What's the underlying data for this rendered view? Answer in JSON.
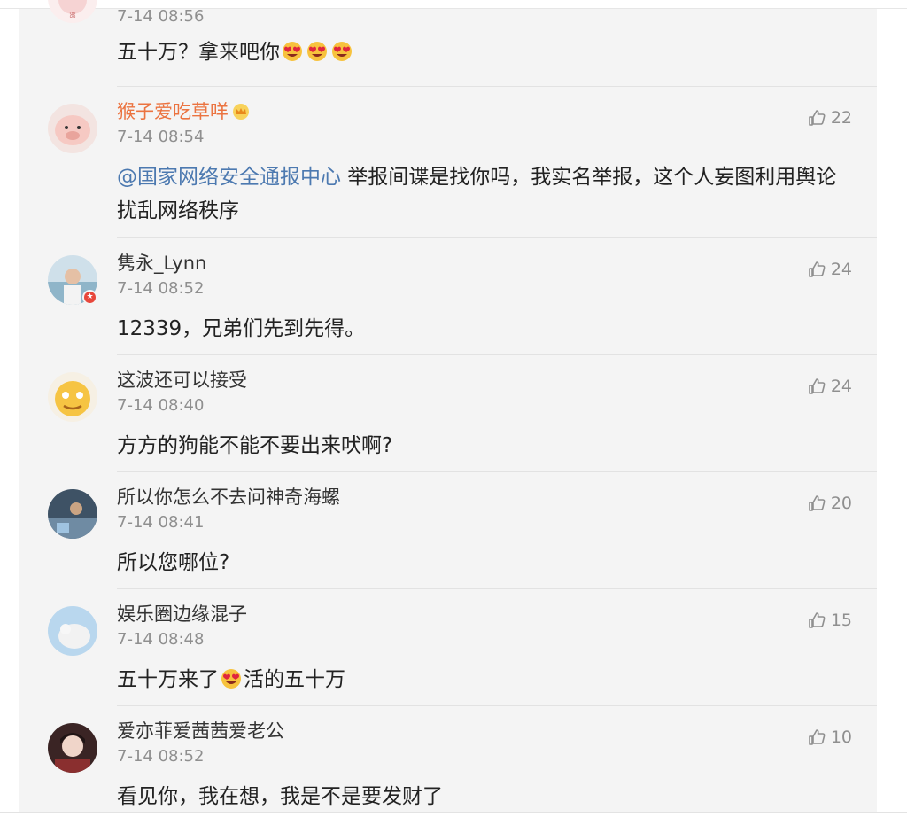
{
  "comments": [
    {
      "name": "",
      "time": "7-14 08:56",
      "text": "五十万？拿来吧你",
      "likes": ""
    },
    {
      "name": "猴子爱吃草咩",
      "time": "7-14 08:54",
      "mention": "@国家网络安全通报中心",
      "text": " 举报间谍是找你吗，我实名举报，这个人妄图利用舆论扰乱网络秩序",
      "likes": "22"
    },
    {
      "name": "隽永_Lynn",
      "time": "7-14 08:52",
      "text": "12339，兄弟们先到先得。",
      "likes": "24"
    },
    {
      "name": "这波还可以接受",
      "time": "7-14 08:40",
      "text": "方方的狗能不能不要出来吠啊?",
      "likes": "24"
    },
    {
      "name": "所以你怎么不去问神奇海螺",
      "time": "7-14 08:41",
      "text": "所以您哪位?",
      "likes": "20"
    },
    {
      "name": "娱乐圈边缘混子",
      "time": "7-14 08:48",
      "text_before": "五十万来了",
      "text_after": "活的五十万",
      "likes": "15"
    },
    {
      "name": "爱亦菲爱茜茜爱老公",
      "time": "7-14 08:52",
      "text": "看见你，我在想，我是不是要发财了",
      "likes": "10"
    }
  ],
  "icons": {
    "like": "thumbs-up-icon",
    "emoji_love": "heart-eyes-emoji",
    "vip": "crown-icon",
    "badge": "star-badge-icon"
  }
}
